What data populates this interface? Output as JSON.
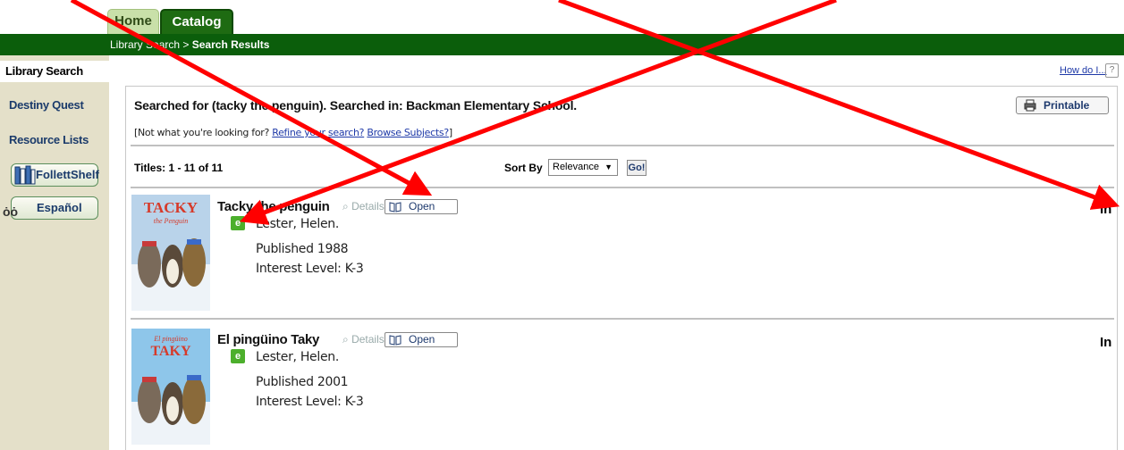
{
  "tabs": {
    "home": "Home",
    "catalog": "Catalog"
  },
  "breadcrumb": {
    "parent": "Library Search",
    "separator": ">",
    "current": "Search Results"
  },
  "sidebar": {
    "active": "Library Search",
    "items": [
      {
        "label": "Destiny Quest"
      },
      {
        "label": "Resource Lists"
      }
    ],
    "follettshelf": "FollettShelf",
    "espanol": "Español"
  },
  "help": {
    "howdo": "How do I...",
    "icon": "?"
  },
  "search": {
    "heading": "Searched for (tacky the penguin). Searched in: Backman Elementary School.",
    "printable": "Printable",
    "notwhat_prefix": "[Not what you're looking for?",
    "refine": "Refine your search?",
    "browse": "Browse Subjects?",
    "notwhat_suffix": "]",
    "titles": "Titles: 1 - 11 of 11",
    "sort_label": "Sort By",
    "sort_value": "Relevance",
    "go": "Go!"
  },
  "results": [
    {
      "title": "Tacky the penguin",
      "details": "Details",
      "open": "Open",
      "author": "Lester, Helen.",
      "published": "Published 1988",
      "interest": "Interest Level: K-3",
      "status": "In",
      "cover_title": "TACKY",
      "cover_sub": "the Penguin"
    },
    {
      "title": "El pingüino Taky",
      "details": "Details",
      "open": "Open",
      "author": "Lester, Helen.",
      "published": "Published 2001",
      "interest": "Interest Level: K-3",
      "status": "In",
      "cover_title": "TAKY",
      "cover_sub": "El pingüino"
    }
  ],
  "colors": {
    "green_bar": "#0b5e0b",
    "sidebar_bg": "#e4e0c9",
    "link": "#1f3aa8",
    "annotation": "#ff0000"
  }
}
